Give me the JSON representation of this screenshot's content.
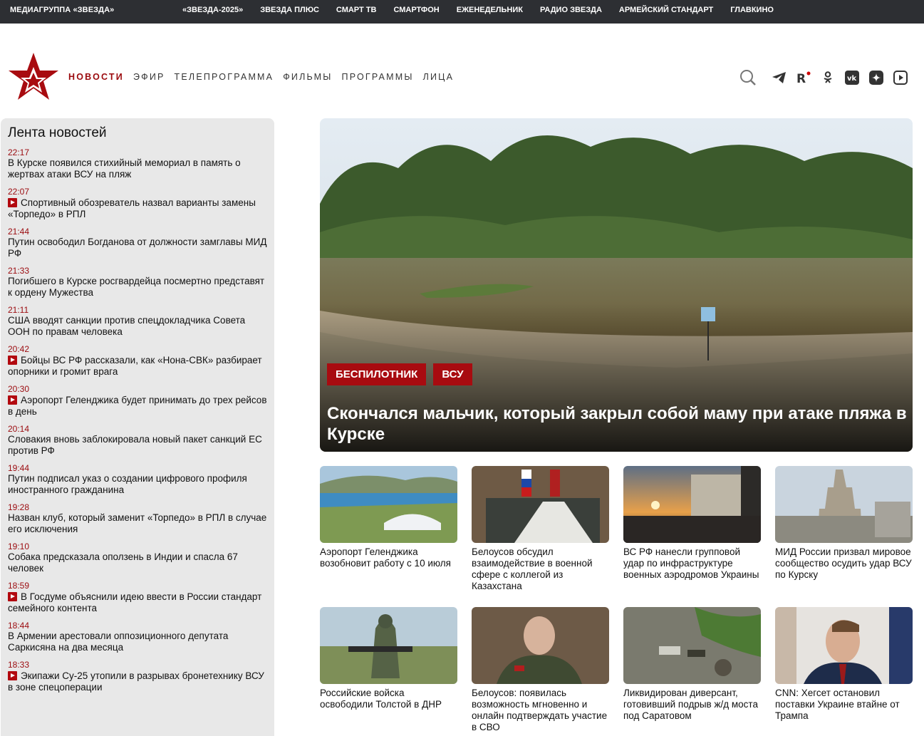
{
  "topbar": {
    "brand": "МЕДИАГРУППА «ЗВЕЗДА»",
    "links": [
      "«ЗВЕЗДА-2025»",
      "ЗВЕЗДА ПЛЮС",
      "СМАРТ ТВ",
      "СМАРТФОН",
      "ЕЖЕНЕДЕЛЬНИК",
      "РАДИО ЗВЕЗДА",
      "АРМЕЙСКИЙ СТАНДАРТ",
      "ГЛАВКИНО"
    ]
  },
  "nav": {
    "items": [
      "НОВОСТИ",
      "ЭФИР",
      "ТЕЛЕПРОГРАММА",
      "ФИЛЬМЫ",
      "ПРОГРАММЫ",
      "ЛИЦА"
    ],
    "active_index": 0
  },
  "header_icons": [
    "search-icon",
    "telegram-icon",
    "rutube-icon",
    "odnoklassniki-icon",
    "vk-icon",
    "dzen-icon",
    "video-icon"
  ],
  "feed": {
    "title": "Лента новостей",
    "items": [
      {
        "time": "22:17",
        "video": false,
        "title": "В Курске появился стихийный мемориал в память о жертвах атаки ВСУ на пляж"
      },
      {
        "time": "22:07",
        "video": true,
        "title": "Спортивный обозреватель назвал варианты замены «Торпедо» в РПЛ"
      },
      {
        "time": "21:44",
        "video": false,
        "title": "Путин освободил Богданова от должности замглавы МИД РФ"
      },
      {
        "time": "21:33",
        "video": false,
        "title": "Погибшего в Курске росгвардейца посмертно представят к ордену Мужества"
      },
      {
        "time": "21:11",
        "video": false,
        "title": "США вводят санкции против спецдокладчика Совета ООН по правам человека"
      },
      {
        "time": "20:42",
        "video": true,
        "title": "Бойцы ВС РФ рассказали, как «Нона-СВК» разбирает опорники и громит врага"
      },
      {
        "time": "20:30",
        "video": true,
        "title": "Аэропорт Геленджика будет принимать до трех рейсов в день"
      },
      {
        "time": "20:14",
        "video": false,
        "title": "Словакия вновь заблокировала новый пакет санкций ЕС против РФ"
      },
      {
        "time": "19:44",
        "video": false,
        "title": "Путин подписал указ о создании цифрового профиля иностранного гражданина"
      },
      {
        "time": "19:28",
        "video": false,
        "title": "Назван клуб, который заменит «Торпедо» в РПЛ в случае его исключения"
      },
      {
        "time": "19:10",
        "video": false,
        "title": "Собака предсказала оползень в Индии и спасла 67 человек"
      },
      {
        "time": "18:59",
        "video": true,
        "title": "В Госдуме объяснили идею ввести в России стандарт семейного контента"
      },
      {
        "time": "18:44",
        "video": false,
        "title": "В Армении арестовали оппозиционного депутата Саркисяна на два месяца"
      },
      {
        "time": "18:33",
        "video": true,
        "title": "Экипажи Су-25 утопили в разрывах бронетехнику ВСУ в зоне спецоперации"
      }
    ]
  },
  "hero": {
    "tags": [
      "БЕСПИЛОТНИК",
      "ВСУ"
    ],
    "headline": "Скончался мальчик, который закрыл собой маму при атаке пляжа в Курске"
  },
  "cards": [
    {
      "title": "Аэропорт Геленджика возобновит работу с 10 июля"
    },
    {
      "title": "Белоусов обсудил взаимодействие в военной сфере с коллегой из Казахстана"
    },
    {
      "title": "ВС РФ нанесли групповой удар по инфраструктуре военных аэродромов Украины"
    },
    {
      "title": "МИД России призвал мировое сообщество осудить удар ВСУ по Курску"
    },
    {
      "title": "Российские войска освободили Толстой в ДНР"
    },
    {
      "title": "Белоусов: появилась возможность мгновенно и онлайн подтверждать участие в СВО"
    },
    {
      "title": "Ликвидирован диверсант, готовивший подрыв ж/д моста под Саратовом"
    },
    {
      "title": "CNN: Хегсет остановил поставки Украине втайне от Трампа"
    }
  ],
  "colors": {
    "accent": "#9b0a0e",
    "tag": "#a80b10",
    "topbar": "#2d2f33",
    "feed_bg": "#e8e8e8"
  }
}
